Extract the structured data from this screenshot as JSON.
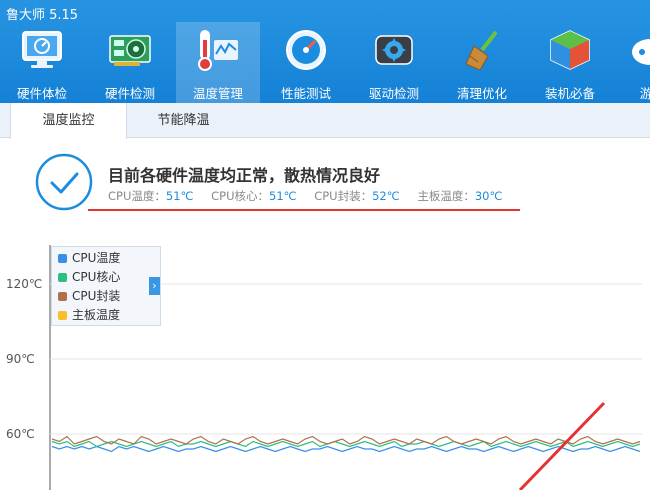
{
  "app": {
    "title": "鲁大师 5.15"
  },
  "nav": [
    {
      "label": "硬件体检",
      "icon": "monitor-icon"
    },
    {
      "label": "硬件检测",
      "icon": "graphics-card-icon"
    },
    {
      "label": "温度管理",
      "icon": "thermometer-icon"
    },
    {
      "label": "性能测试",
      "icon": "speedometer-icon"
    },
    {
      "label": "驱动检测",
      "icon": "driver-gear-icon"
    },
    {
      "label": "清理优化",
      "icon": "broom-icon"
    },
    {
      "label": "装机必备",
      "icon": "software-box-icon"
    },
    {
      "label": "游",
      "icon": "game-icon"
    }
  ],
  "subtabs": [
    {
      "label": "温度监控"
    },
    {
      "label": "节能降温"
    }
  ],
  "status": {
    "title": "目前各硬件温度均正常，散热情况良好",
    "readings": [
      {
        "label": "CPU温度：",
        "value": "51℃"
      },
      {
        "label": "CPU核心：",
        "value": "51℃"
      },
      {
        "label": "CPU封装：",
        "value": "52℃"
      },
      {
        "label": "主板温度：",
        "value": "30℃"
      }
    ]
  },
  "colors": {
    "accent": "#1b8de0",
    "underline": "#e53232"
  },
  "chart_data": {
    "type": "line",
    "ylabel": "",
    "yticks": [
      "120℃",
      "90℃",
      "60℃"
    ],
    "yticks_values": [
      120,
      90,
      60
    ],
    "ylim": [
      45,
      140
    ],
    "legend": [
      {
        "name": "CPU温度",
        "color": "#3b8ee8"
      },
      {
        "name": "CPU核心",
        "color": "#2dbf80"
      },
      {
        "name": "CPU封装",
        "color": "#b0704a"
      },
      {
        "name": "主板温度",
        "color": "#f5c02a"
      }
    ],
    "series": [
      {
        "name": "CPU温度",
        "color": "#3b8ee8",
        "values": [
          55,
          54,
          55,
          54,
          55,
          54,
          55,
          54,
          53,
          55,
          54,
          55,
          54,
          53,
          54,
          55,
          54,
          53,
          54,
          54,
          55,
          54,
          53,
          54,
          55,
          54,
          53,
          54,
          55,
          54,
          53,
          54,
          55,
          54,
          53,
          54,
          54,
          55,
          54,
          53,
          54,
          55,
          54,
          54,
          53,
          54,
          55,
          54,
          53,
          54,
          54,
          55,
          54,
          53,
          54,
          55,
          54,
          54,
          53,
          54,
          55,
          54,
          53,
          54,
          55,
          54,
          53,
          54,
          55,
          54,
          53,
          54,
          54,
          55,
          54,
          53,
          54,
          55,
          54,
          53
        ]
      },
      {
        "name": "CPU核心",
        "color": "#2dbf80",
        "values": [
          57,
          56,
          57,
          55,
          56,
          57,
          55,
          56,
          57,
          56,
          55,
          56,
          57,
          56,
          55,
          56,
          57,
          55,
          56,
          56,
          57,
          56,
          55,
          56,
          57,
          56,
          55,
          57,
          56,
          55,
          56,
          57,
          56,
          55,
          56,
          57,
          55,
          56,
          57,
          56,
          55,
          56,
          57,
          56,
          55,
          56,
          57,
          55,
          56,
          56,
          57,
          56,
          55,
          56,
          57,
          56,
          55,
          56,
          57,
          55,
          56,
          57,
          56,
          55,
          56,
          57,
          56,
          55,
          56,
          57,
          55,
          56,
          57,
          56,
          55,
          56,
          57,
          56,
          55,
          56
        ]
      },
      {
        "name": "CPU封装",
        "color": "#b0704a",
        "values": [
          58,
          57,
          59,
          56,
          57,
          58,
          59,
          57,
          56,
          58,
          57,
          56,
          59,
          58,
          56,
          57,
          58,
          57,
          56,
          58,
          59,
          57,
          56,
          58,
          57,
          56,
          58,
          59,
          57,
          56,
          57,
          58,
          57,
          56,
          58,
          59,
          57,
          56,
          57,
          58,
          56,
          57,
          59,
          58,
          56,
          57,
          58,
          57,
          56,
          58,
          57,
          56,
          58,
          59,
          57,
          56,
          57,
          58,
          57,
          56,
          58,
          59,
          57,
          56,
          57,
          58,
          57,
          56,
          58,
          57,
          56,
          58,
          59,
          57,
          56,
          57,
          58,
          57,
          56,
          57
        ]
      }
    ]
  }
}
